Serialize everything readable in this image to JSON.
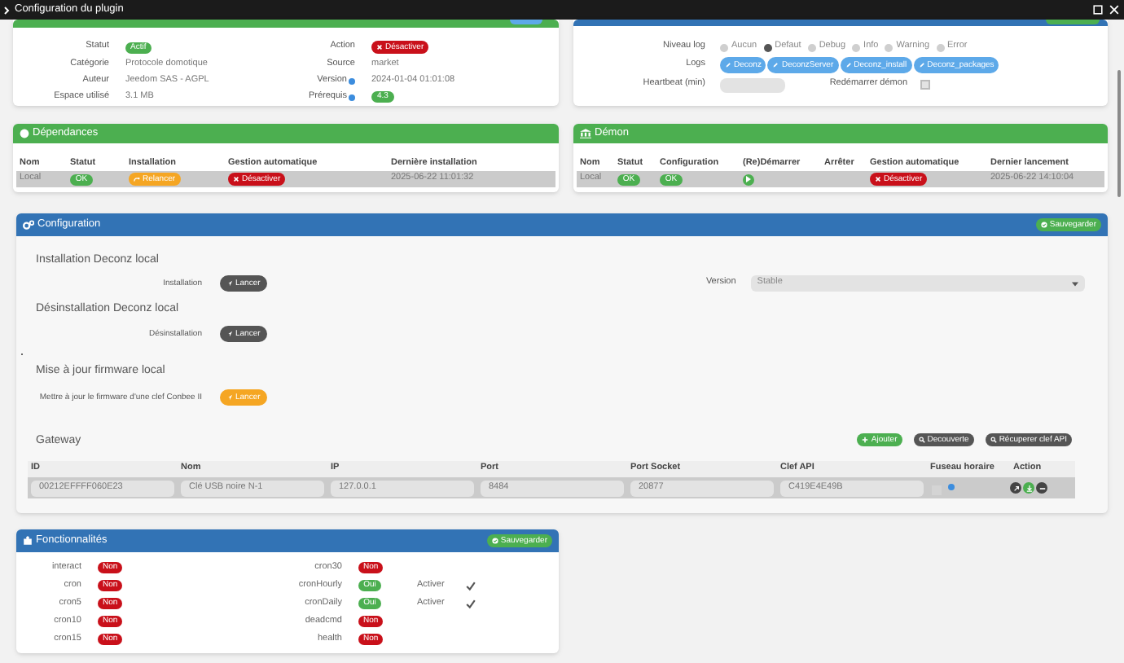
{
  "window": {
    "title": "Configuration du plugin"
  },
  "etat": {
    "left": [
      {
        "label": "Statut",
        "value": "Actif",
        "kind": "badge"
      },
      {
        "label": "Catégorie",
        "value": "Protocole domotique",
        "kind": "text"
      },
      {
        "label": "Auteur",
        "value": "Jeedom SAS - AGPL",
        "kind": "text"
      },
      {
        "label": "Espace utilisé",
        "value": "3.1 MB",
        "kind": "text"
      }
    ],
    "right": [
      {
        "label": "Action",
        "value": "Désactiver",
        "kind": "danger_button"
      },
      {
        "label": "Source",
        "value": "market",
        "kind": "text"
      },
      {
        "label": "Version",
        "value": "2024-01-04 01:01:08",
        "kind": "text",
        "help": true
      },
      {
        "label": "Prérequis",
        "value": "4.3",
        "kind": "badge",
        "help": true
      }
    ]
  },
  "logs": {
    "level_label": "Niveau log",
    "levels": [
      {
        "label": "Aucun",
        "selected": false
      },
      {
        "label": "Defaut",
        "selected": true
      },
      {
        "label": "Debug",
        "selected": false
      },
      {
        "label": "Info",
        "selected": false
      },
      {
        "label": "Warning",
        "selected": false
      },
      {
        "label": "Error",
        "selected": false
      }
    ],
    "logs_label": "Logs",
    "log_buttons": [
      "Deconz",
      "DeconzServer",
      "Deconz_install",
      "Deconz_packages"
    ],
    "heartbeat_label": "Heartbeat (min)",
    "restart": {
      "label": "Redémarrer démon",
      "checked": false
    }
  },
  "dependances": {
    "title": "Dépendances",
    "columns": [
      "Nom",
      "Statut",
      "Installation",
      "Gestion automatique",
      "Dernière installation"
    ],
    "rows": [
      {
        "nom": "Local",
        "statut": "OK",
        "installation": "Relancer",
        "gestion": "Désactiver",
        "date": "2025-06-22 11:01:32"
      }
    ]
  },
  "demon": {
    "title": "Démon",
    "columns": [
      "Nom",
      "Statut",
      "Configuration",
      "(Re)Démarrer",
      "Arrêter",
      "Gestion automatique",
      "Dernier lancement"
    ],
    "rows": [
      {
        "nom": "Local",
        "statut": "OK",
        "configuration": "OK",
        "gestion": "Désactiver",
        "date": "2025-06-22 14:10:04"
      }
    ]
  },
  "configuration": {
    "title": "Configuration",
    "save": "Sauvegarder",
    "sections": [
      {
        "title": "Installation Deconz local",
        "label": "Installation",
        "button": "Lancer",
        "kind": "dark"
      },
      {
        "title": "Désinstallation Deconz local",
        "label": "Désinstallation",
        "button": "Lancer",
        "kind": "dark"
      },
      {
        "title": "Mise à jour firmware local",
        "label": "Mettre à jour le firmware d'une clef Conbee II",
        "button": "Lancer",
        "kind": "warning"
      }
    ],
    "version": {
      "label": "Version",
      "value": "Stable"
    },
    "gateway": {
      "title": "Gateway",
      "buttons": [
        {
          "label": "Ajouter",
          "kind": "success"
        },
        {
          "label": "Decouverte",
          "kind": "dark"
        },
        {
          "label": "Récuperer clef API",
          "kind": "dark"
        }
      ],
      "columns": [
        "ID",
        "Nom",
        "IP",
        "Port",
        "Port Socket",
        "Clef API",
        "Fuseau horaire",
        "Action"
      ],
      "rows": [
        {
          "cells": [
            "00212EFFFF060E23",
            "Clé USB noire N-1",
            "127.0.0.1",
            "8484",
            "20877",
            "C419E4E49B"
          ],
          "timezone": false
        }
      ]
    }
  },
  "fonctionnalites": {
    "title": "Fonctionnalités",
    "save": "Sauvegarder",
    "columns": [
      [
        {
          "name": "interact",
          "value": "Non",
          "on": false
        },
        {
          "name": "cron",
          "value": "Non",
          "on": false
        },
        {
          "name": "cron5",
          "value": "Non",
          "on": false
        },
        {
          "name": "cron10",
          "value": "Non",
          "on": false
        },
        {
          "name": "cron15",
          "value": "Non",
          "on": false
        }
      ],
      [
        {
          "name": "cron30",
          "value": "Non",
          "on": false
        },
        {
          "name": "cronHourly",
          "value": "Oui",
          "on": true,
          "activer": {
            "label": "Activer",
            "checked": true
          }
        },
        {
          "name": "cronDaily",
          "value": "Oui",
          "on": true,
          "activer": {
            "label": "Activer",
            "checked": true
          }
        },
        {
          "name": "deadcmd",
          "value": "Non",
          "on": false
        },
        {
          "name": "health",
          "value": "Non",
          "on": false
        }
      ]
    ]
  }
}
